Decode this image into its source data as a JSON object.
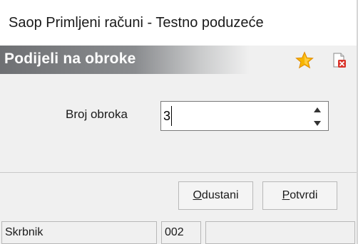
{
  "window": {
    "title": "Saop Primljeni računi - Testno poduzeće"
  },
  "panel": {
    "title": "Podijeli na obroke",
    "icons": {
      "favorite": "star-icon",
      "close": "close-document-icon"
    }
  },
  "form": {
    "installments_label": "Broj obroka",
    "installments_value": "3"
  },
  "buttons": {
    "cancel": {
      "label": "Odustani",
      "access_key": "O",
      "rest": "dustani"
    },
    "confirm": {
      "label": "Potvrdi",
      "access_key": "P",
      "rest": "otvrdi"
    }
  },
  "status": {
    "user": "Skrbnik",
    "code": "002",
    "extra": ""
  },
  "colors": {
    "star": "#f5b400",
    "close_red": "#d9342b",
    "title_text": "#ffffff"
  }
}
